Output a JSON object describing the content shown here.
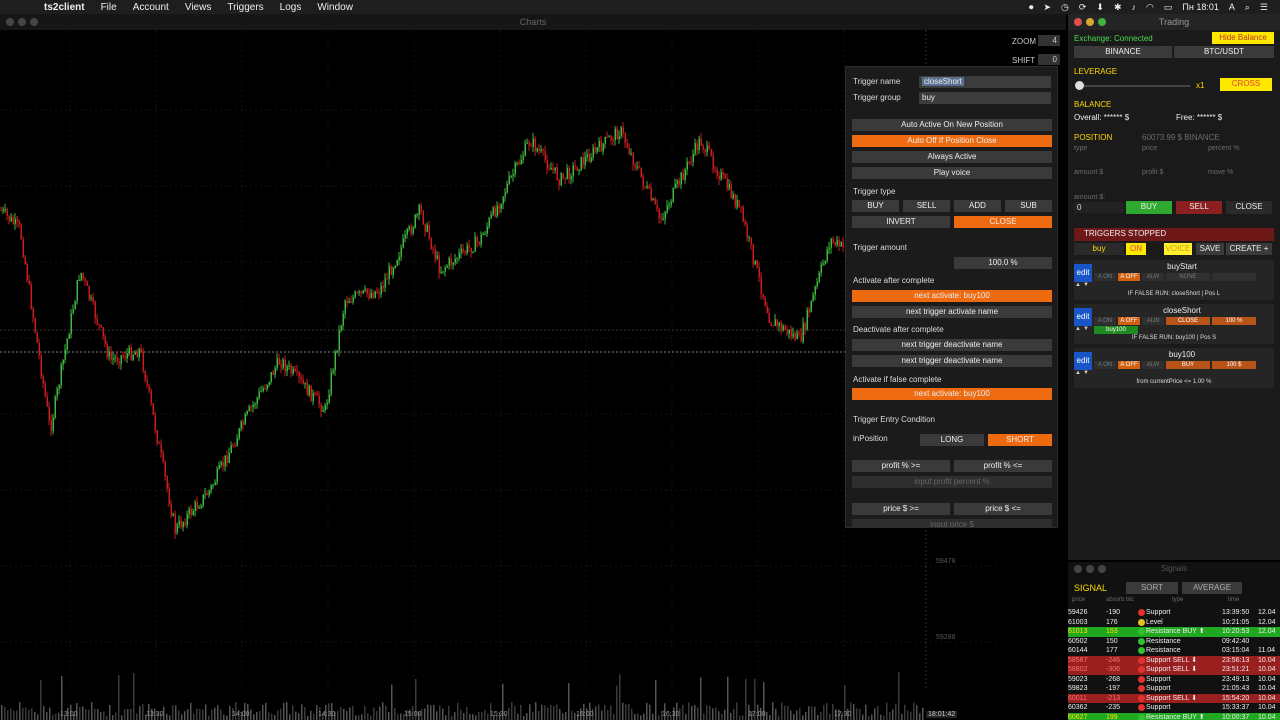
{
  "menubar": {
    "app": "ts2client",
    "items": [
      "File",
      "Account",
      "Views",
      "Triggers",
      "Logs",
      "Window"
    ],
    "clock": "Пн 18:01",
    "input_source": "A"
  },
  "charts": {
    "window_title": "Charts",
    "zoom_label": "ZOOM",
    "zoom_value": "4",
    "shift_label": "SHIFT",
    "shift_value": "0",
    "price_labels": [
      "59478",
      "59288"
    ],
    "time_labels": [
      "13:00",
      "13:30",
      "14:00",
      "14:30",
      "15:00",
      "15:30",
      "16:00",
      "16:30",
      "17:00",
      "17:30"
    ],
    "current_time": "18:01:42"
  },
  "dialog": {
    "trigger_name_label": "Trigger name",
    "trigger_name_value": "closeShort",
    "trigger_group_label": "Trigger group",
    "trigger_group_value": "buy",
    "auto_active_new": "Auto Active On New Position",
    "auto_off_close": "Auto Off If Position Close",
    "always_active": "Always Active",
    "play_voice": "Play voice",
    "trigger_type_label": "Trigger type",
    "type_buy": "BUY",
    "type_sell": "SELL",
    "type_add": "ADD",
    "type_sub": "SUB",
    "type_invert": "INVERT",
    "type_close": "CLOSE",
    "trigger_amount_label": "Trigger amount",
    "trigger_amount_value": "100.0 %",
    "activate_after_label": "Activate after complete",
    "next_activate_1": "next activate: buy100",
    "next_trigger_activate": "next trigger activate name",
    "deactivate_after_label": "Deactivate after complete",
    "next_trigger_deactivate_1": "next trigger deactivate name",
    "next_trigger_deactivate_2": "next trigger deactivate name",
    "activate_false_label": "Activate if false complete",
    "next_activate_2": "next activate: buy100",
    "entry_condition_label": "Trigger Entry Condition",
    "in_position_label": "inPosition",
    "long": "LONG",
    "short": "SHORT",
    "profit_ge": "profit % >=",
    "profit_le": "profit % <=",
    "input_profit_placeholder": "input profit percent %",
    "price_ge": "price $ >=",
    "price_le": "price $ <=",
    "input_price_placeholder": "input price $"
  },
  "trading": {
    "window_title": "Trading",
    "exchange_status": "Exchange: Connected",
    "hide_balance": "Hide Balance",
    "exchange": "BINANCE",
    "pair": "BTC/USDT",
    "leverage_label": "LEVERAGE",
    "leverage_value": "x1",
    "leverage_level": 0,
    "cross": "CROSS",
    "balance_label": "BALANCE",
    "overall": "Overall: ****** $",
    "free": "Free: ****** $",
    "position_label": "POSITION",
    "position_value": "60073.99 $ BINANCE",
    "col_type": "type",
    "col_price": "price",
    "col_percent": "percent %",
    "col_amount": "amount $",
    "col_profit": "profit $",
    "col_move": "move %",
    "amount_input_label": "amount $:",
    "amount_input_value": "0",
    "buy": "BUY",
    "sell": "SELL",
    "close": "CLOSE",
    "triggers_stopped": "TRIGGERS STOPPED",
    "group_buy": "buy",
    "group_on": "ON",
    "voice": "VOICE",
    "save": "SAVE",
    "create": "CREATE +",
    "edit": "edit",
    "triggers": [
      {
        "name": "buyStart",
        "action": "NONE",
        "amount": "",
        "footer": "IF FALSE RUN: closeShort | Pos L",
        "next": ""
      },
      {
        "name": "closeShort",
        "action": "CLOSE",
        "amount": "100 %",
        "footer": "IF FALSE RUN: buy100 | Pos S",
        "next": "buy100"
      },
      {
        "name": "buy100",
        "action": "BUY",
        "amount": "100 $",
        "footer": "from currentPrice <= 1.00 %",
        "next": ""
      }
    ],
    "mini_aon": "A ON",
    "mini_aoff": "A OFF",
    "mini_alw": "ALW"
  },
  "signals": {
    "window_title": "Signals",
    "signal_label": "SIGNAL",
    "sort": "SORT",
    "average": "AVERAGE",
    "col_price": "price",
    "col_absorb": "absorb btc",
    "col_type": "type",
    "col_time": "time",
    "rows": [
      {
        "price": "59426",
        "absorb": "-190",
        "type": "Support",
        "time": "13:39:50",
        "date": "12.04",
        "dot": "#e53030",
        "bg": "",
        "pc": "#eee",
        "ac": "#eee"
      },
      {
        "price": "61003",
        "absorb": "176",
        "type": "Level",
        "time": "10:21:05",
        "date": "12.04",
        "dot": "#e5c020",
        "bg": "",
        "pc": "#eee",
        "ac": "#eee"
      },
      {
        "price": "61013",
        "absorb": "153",
        "type": "Resistance BUY ⬆",
        "time": "10:20:53",
        "date": "12.04",
        "dot": "#30c030",
        "bg": "#21a821",
        "pc": "#ffe000",
        "ac": "#ffe000"
      },
      {
        "price": "60502",
        "absorb": "150",
        "type": "Resistance",
        "time": "09:42:40",
        "date": "",
        "dot": "#30c030",
        "bg": "",
        "pc": "#eee",
        "ac": "#eee"
      },
      {
        "price": "60144",
        "absorb": "177",
        "type": "Resistance",
        "time": "03:15:04",
        "date": "11.04",
        "dot": "#30c030",
        "bg": "",
        "pc": "#eee",
        "ac": "#eee"
      },
      {
        "price": "58587",
        "absorb": "-246",
        "type": "Support SELL ⬇",
        "time": "23:56:13",
        "date": "10.04",
        "dot": "#e53030",
        "bg": "#9a1f1f",
        "pc": "#ff7070",
        "ac": "#ff7070"
      },
      {
        "price": "58802",
        "absorb": "-306",
        "type": "Support SELL ⬇",
        "time": "23:51:21",
        "date": "10.04",
        "dot": "#e53030",
        "bg": "#9a1f1f",
        "pc": "#ff7070",
        "ac": "#ff7070"
      },
      {
        "price": "59023",
        "absorb": "-268",
        "type": "Support",
        "time": "23:49:13",
        "date": "10.04",
        "dot": "#e53030",
        "bg": "",
        "pc": "#eee",
        "ac": "#eee"
      },
      {
        "price": "59823",
        "absorb": "-197",
        "type": "Support",
        "time": "21:05:43",
        "date": "10.04",
        "dot": "#e53030",
        "bg": "",
        "pc": "#eee",
        "ac": "#eee"
      },
      {
        "price": "60011",
        "absorb": "-213",
        "type": "Support SELL ⬇",
        "time": "15:54:20",
        "date": "10.04",
        "dot": "#e53030",
        "bg": "#9a1f1f",
        "pc": "#ff7070",
        "ac": "#ff7070"
      },
      {
        "price": "60362",
        "absorb": "-235",
        "type": "Support",
        "time": "15:33:37",
        "date": "10.04",
        "dot": "#e53030",
        "bg": "",
        "pc": "#eee",
        "ac": "#eee"
      },
      {
        "price": "60627",
        "absorb": "199",
        "type": "Resistance BUY ⬆",
        "time": "10:00:37",
        "date": "10.04",
        "dot": "#30c030",
        "bg": "#21a821",
        "pc": "#ffe000",
        "ac": "#ffe000"
      }
    ]
  },
  "colors": {
    "orange": "#ee6a10",
    "yellow": "#ffd900",
    "green": "#2fa82f",
    "red": "#8c1f1f",
    "candle_up": "#3fb93f",
    "candle_down": "#c81e1e"
  }
}
